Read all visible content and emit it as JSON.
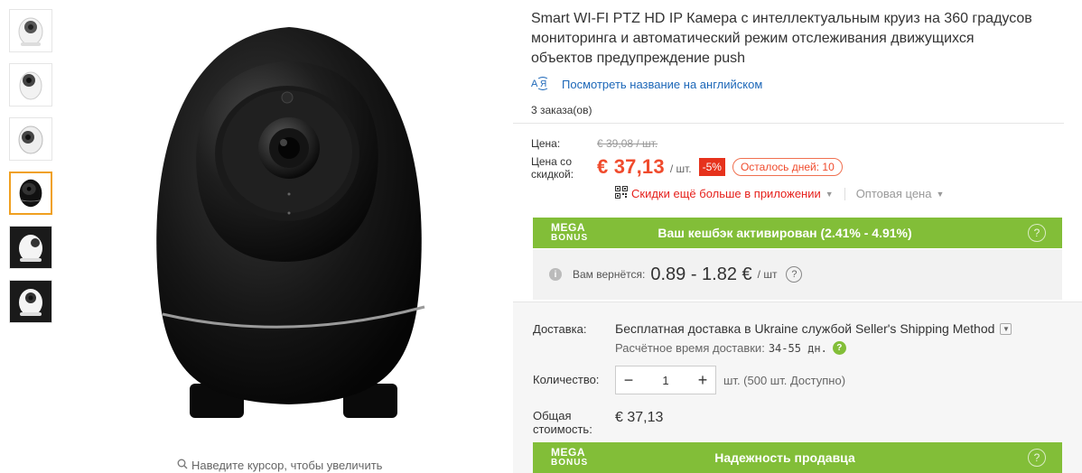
{
  "thumbnails": [
    {
      "name": "thumb-white-camera-1",
      "active": false
    },
    {
      "name": "thumb-white-camera-2",
      "active": false
    },
    {
      "name": "thumb-white-camera-3",
      "active": false
    },
    {
      "name": "thumb-black-camera",
      "active": true
    },
    {
      "name": "thumb-white-camera-dark-bg",
      "active": false
    },
    {
      "name": "thumb-white-camera-dark-bg-2",
      "active": false
    }
  ],
  "gallery": {
    "zoom_hint": "Наведите курсор, чтобы увеличить"
  },
  "product": {
    "title": "Smart WI-FI PTZ HD IP Камера с интеллектуальным круиз на 360 градусов мониторинга и автоматический режим отслеживания движущихся объектов предупреждение push",
    "translate_link": "Посмотреть название на английском",
    "orders": "3 заказа(ов)"
  },
  "price": {
    "label": "Цена:",
    "old": "€ 39,08 / шт.",
    "discount_label": "Цена со скидкой:",
    "new": "€ 37,13",
    "per_unit": "/ шт.",
    "percent": "-5%",
    "days_left": "Осталось дней: 10",
    "app_discount": "Скидки ещё больше в приложении",
    "wholesale": "Оптовая цена"
  },
  "mega_bonus": {
    "logo_top": "MEGA",
    "logo_bottom": "BONUS",
    "cashback_banner": "Ваш кешбэк активирован (2.41% - 4.91%)",
    "seller_banner": "Надежность продавца",
    "help": "?"
  },
  "cashback": {
    "label": "Вам вернётся:",
    "value": "0.89 - 1.82 €",
    "unit": "/ шт",
    "info": "i",
    "help": "?"
  },
  "delivery": {
    "label": "Доставка:",
    "value": "Бесплатная доставка в Ukraine службой Seller's Shipping Method",
    "eta_label": "Расчётное время доставки:",
    "eta_value": "34-55 дн.",
    "help": "?"
  },
  "quantity": {
    "label": "Количество:",
    "minus": "−",
    "value": "1",
    "plus": "+",
    "available": "шт. (500 шт. Доступно)"
  },
  "total": {
    "label": "Общая стоимость:",
    "value": "€ 37,13"
  },
  "colors": {
    "accent_orange": "#f04b2d",
    "mega_green": "#82be38",
    "link_blue": "#1c67b8"
  }
}
